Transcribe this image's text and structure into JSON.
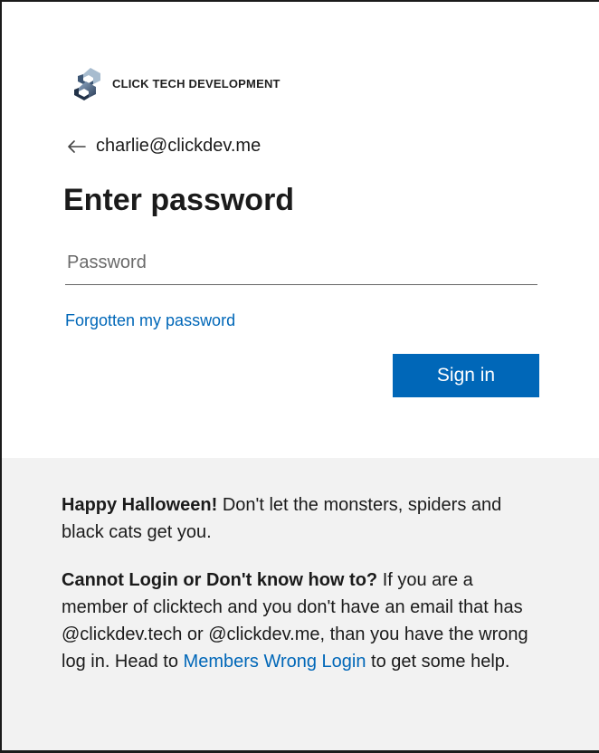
{
  "brand": {
    "logo_text": "CLICK TECH DEVELOPMENT",
    "logo_icon": "chain-link-logo-icon"
  },
  "identity": {
    "back_icon": "arrow-left-icon",
    "email": "charlie@clickdev.me"
  },
  "page": {
    "title": "Enter password"
  },
  "password": {
    "placeholder": "Password",
    "value": ""
  },
  "links": {
    "forgot_password": "Forgotten my password"
  },
  "buttons": {
    "sign_in": "Sign in"
  },
  "info": {
    "halloween_bold": "Happy Halloween!",
    "halloween_text": " Don't let the monsters, spiders and black cats get you.",
    "login_help_bold": "Cannot Login or Don't know how to?",
    "login_help_text": " If you are a member of clicktech and you don't have an email that has @clickdev.tech or @clickdev.me, than you have the wrong log in. Head to ",
    "login_help_link": "Members Wrong Login",
    "login_help_tail": " to get some help."
  },
  "colors": {
    "accent": "#0067b8",
    "footer_bg": "#f2f2f2",
    "page_bg": "#ffffff"
  }
}
